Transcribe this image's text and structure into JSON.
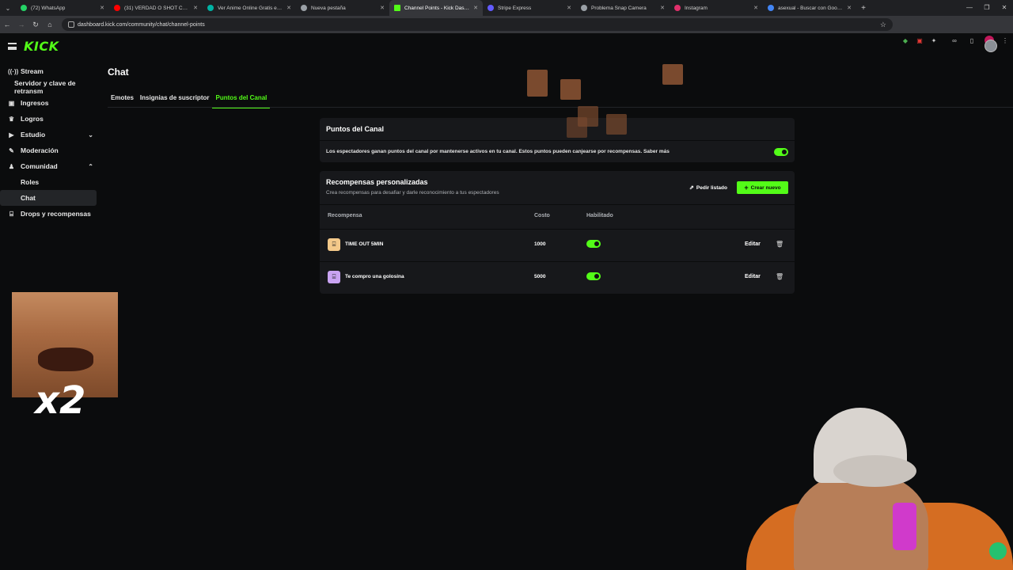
{
  "browser": {
    "tabs": [
      {
        "title": "(72) WhatsApp",
        "icon": "whatsapp-icon",
        "color": "#25d366"
      },
      {
        "title": "(31) VERDAD O SHOT CON PAU",
        "icon": "youtube-icon",
        "color": "#ff0000"
      },
      {
        "title": "Ver Anime Online Gratis en HD",
        "icon": "anime-icon",
        "color": "#00b3a4"
      },
      {
        "title": "Nueva pestaña",
        "icon": "chrome-icon",
        "color": "#9aa0a6"
      },
      {
        "title": "Channel Points - Kick Dashboard",
        "icon": "kick-icon",
        "color": "#53fc18",
        "active": true
      },
      {
        "title": "Stripe Express",
        "icon": "stripe-icon",
        "color": "#635bff"
      },
      {
        "title": "Problema Snap Camera",
        "icon": "snap-icon",
        "color": "#9aa0a6"
      },
      {
        "title": "Instagram",
        "icon": "instagram-icon",
        "color": "#e1306c"
      },
      {
        "title": "asexual - Buscar con Google",
        "icon": "google-icon",
        "color": "#4285f4"
      }
    ],
    "url": "dashboard.kick.com/community/chat/channel-points"
  },
  "app": {
    "logo": "KICK"
  },
  "sidebar": {
    "items": [
      {
        "label": "Stream",
        "icon": "broadcast-icon",
        "level": 0
      },
      {
        "label": "Servidor y clave de retransm",
        "level": 2
      },
      {
        "label": "Ingresos",
        "icon": "wallet-icon",
        "level": 0
      },
      {
        "label": "Logros",
        "icon": "trophy-icon",
        "level": 0
      },
      {
        "label": "Estudio",
        "icon": "video-icon",
        "level": 0,
        "chevron": "⌄"
      },
      {
        "label": "Moderación",
        "icon": "wrench-icon",
        "level": 0
      },
      {
        "label": "Comunidad",
        "icon": "people-icon",
        "level": 0,
        "chevron": "⌃"
      },
      {
        "label": "Roles",
        "level": 1
      },
      {
        "label": "Chat",
        "level": 1,
        "active": true
      },
      {
        "label": "Drops y recompensas",
        "icon": "gift-icon",
        "level": 0
      }
    ]
  },
  "main": {
    "title": "Chat",
    "tabs": [
      {
        "label": "Emotes"
      },
      {
        "label": "Insignias de suscriptor"
      },
      {
        "label": "Puntos del Canal",
        "active": true
      }
    ]
  },
  "channel_points": {
    "title": "Puntos del Canal",
    "description": "Los espectadores ganan puntos del canal por mantenerse activos en tu canal. Estos puntos pueden canjearse por recompensas. Saber más",
    "enabled": true
  },
  "rewards": {
    "title": "Recompensas personalizadas",
    "subtitle": "Crea recompensas para desafiar y darle reconocimiento a tus espectadores",
    "request_list_label": "Pedir listado",
    "create_label": "Crear nuevo",
    "columns": [
      "Recompensa",
      "Costo",
      "Habilitado"
    ],
    "items": [
      {
        "name": "TIME OUT 5MIN",
        "cost": "1000",
        "enabled": true,
        "color": "#f4c98a",
        "edit_label": "Editar"
      },
      {
        "name": "Te compro una golosina",
        "cost": "5000",
        "enabled": true,
        "color": "#c9a3f2",
        "edit_label": "Editar"
      }
    ]
  },
  "overlay": {
    "multiplier": "x2"
  },
  "colors": {
    "accent": "#53fc18",
    "background": "#0b0c0d",
    "card": "#17181b"
  }
}
